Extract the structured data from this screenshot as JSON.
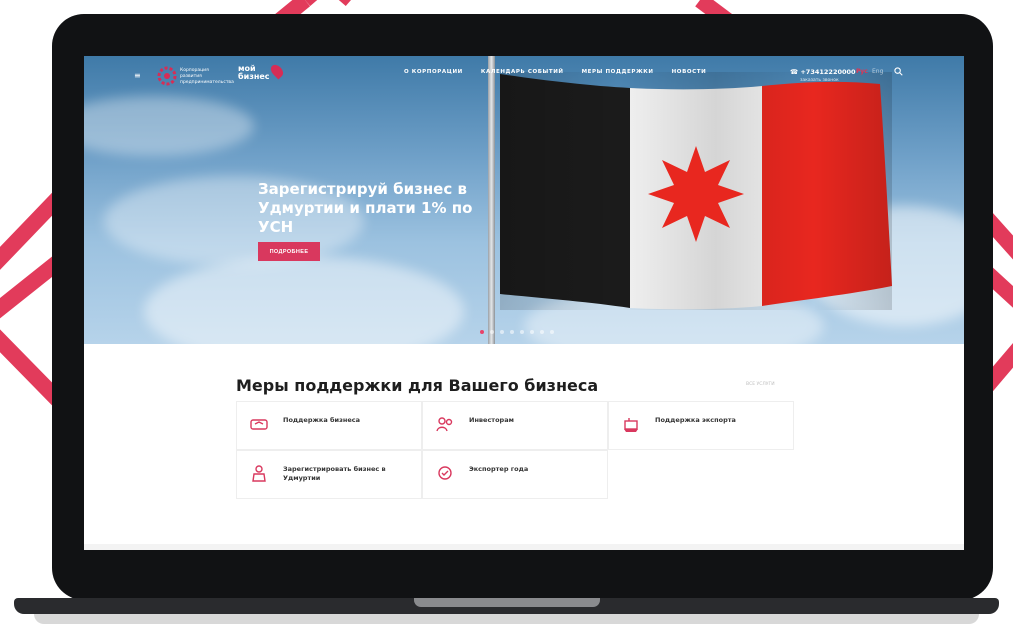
{
  "colors": {
    "accent": "#d9385e",
    "flag_black": "#1b1b1b",
    "flag_white": "#f2f2f2",
    "flag_red": "#e8271f"
  },
  "header": {
    "logo_text": "Корпорация развития предпринимательства",
    "logo_moy_line1": "мой",
    "logo_moy_line2": "бизнес",
    "nav": [
      "О КОРПОРАЦИИ",
      "КАЛЕНДАРЬ СОБЫТИЙ",
      "МЕРЫ ПОДДЕРЖКИ",
      "НОВОСТИ"
    ],
    "phone": "+73412220000",
    "phone_sub": "заказать звонок",
    "lang_active": "Рус",
    "lang_other": "Eng",
    "icons": {
      "menu": "hamburger-icon",
      "search": "search-icon",
      "phone": "phone-icon"
    }
  },
  "hero": {
    "title_line1": "Зарегистрируй бизнес в",
    "title_line2": "Удмуртии и плати 1% по УСН",
    "button_label": "ПОДРОБНЕЕ",
    "slides_total": 8,
    "active_slide": 1
  },
  "support": {
    "title": "Меры поддержки для Вашего бизнеса",
    "all_link": "ВСЕ УСЛУГИ",
    "items": [
      {
        "label": "Поддержка бизнеса",
        "icon": "handshake-icon"
      },
      {
        "label": "Инвесторам",
        "icon": "investors-icon"
      },
      {
        "label": "Поддержка экспорта",
        "icon": "export-icon"
      },
      {
        "label": "Зарегистрировать бизнес в Удмуртии",
        "icon": "register-icon"
      },
      {
        "label": "Экспортер года",
        "icon": "award-icon"
      }
    ]
  }
}
